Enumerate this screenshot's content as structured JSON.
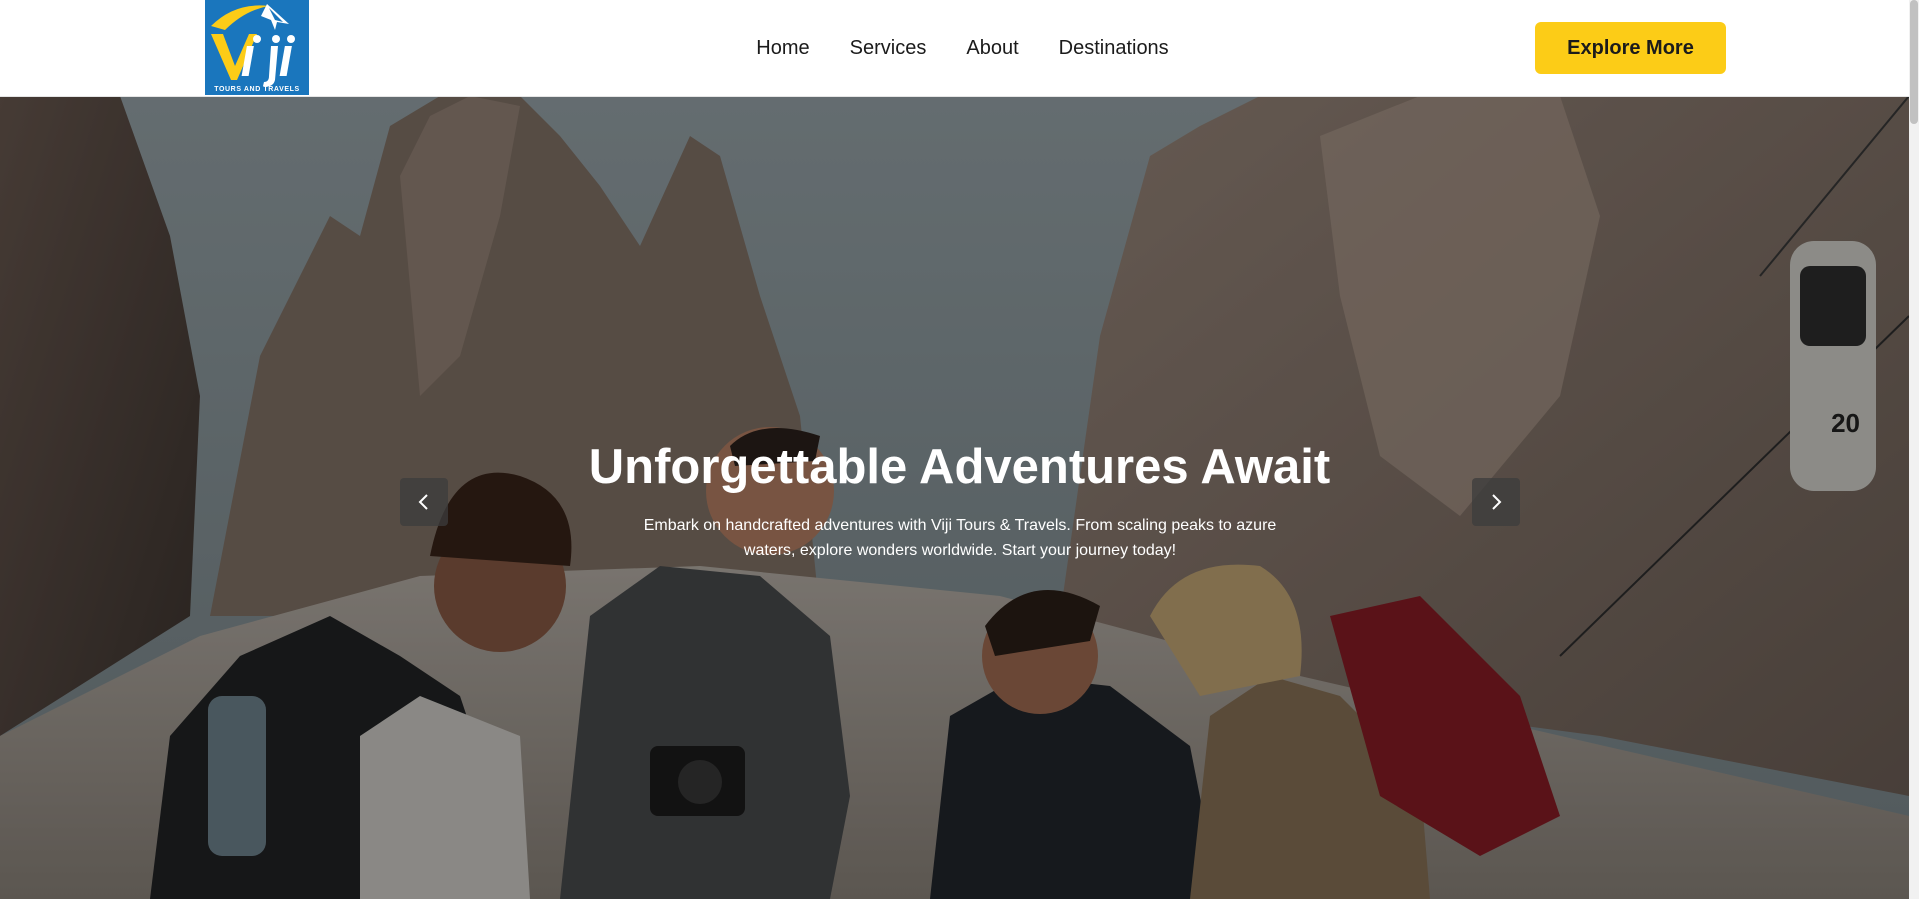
{
  "brand": {
    "logo_letters": "Viji",
    "tagline": "TOURS AND TRAVELS",
    "color_blue": "#1a76bd",
    "color_yellow": "#fccc17"
  },
  "nav": {
    "items": [
      {
        "label": "Home"
      },
      {
        "label": "Services"
      },
      {
        "label": "About"
      },
      {
        "label": "Destinations"
      }
    ]
  },
  "header": {
    "cta_label": "Explore More"
  },
  "hero": {
    "title": "Unforgettable Adventures Await",
    "text": "Embark on handcrafted adventures with Viji Tours & Travels. From scaling peaks to azure waters, explore wonders worldwide. Start your journey today!",
    "prev_icon": "chevron-left-icon",
    "next_icon": "chevron-right-icon",
    "cable_car_number": "20"
  }
}
